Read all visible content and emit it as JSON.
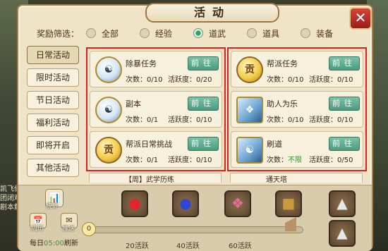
{
  "window": {
    "title": "活动",
    "close_label": "✕"
  },
  "filter": {
    "label": "奖励筛选：",
    "options": [
      {
        "label": "全部",
        "selected": false
      },
      {
        "label": "经验",
        "selected": false
      },
      {
        "label": "道武",
        "selected": true
      },
      {
        "label": "道具",
        "selected": false
      },
      {
        "label": "装备",
        "selected": false
      }
    ]
  },
  "sidebar": {
    "items": [
      {
        "label": "日常活动",
        "active": true
      },
      {
        "label": "限时活动",
        "active": false
      },
      {
        "label": "节日活动",
        "active": false
      },
      {
        "label": "福利活动",
        "active": false
      },
      {
        "label": "即将开启",
        "active": false
      },
      {
        "label": "其他活动",
        "active": false
      }
    ]
  },
  "cards": [
    {
      "title": "除暴任务",
      "count": "次数：0/10",
      "activity": "活跃度：0/20",
      "go": "前往",
      "icon": "taiji-icon"
    },
    {
      "title": "帮派任务",
      "count": "次数：0/10",
      "activity": "活跃度：0/10",
      "go": "前往",
      "icon": "coin-icon"
    },
    {
      "title": "副本",
      "count": "次数：0/1",
      "activity": "活跃度：0/10",
      "go": "前往",
      "icon": "taiji-icon"
    },
    {
      "title": "助人为乐",
      "count": "次数：0/10",
      "activity": "活跃度：0/10",
      "go": "前往",
      "icon": "book-icon"
    },
    {
      "title": "帮派日常挑战",
      "count": "次数：0/1",
      "activity": "活跃度：0/10",
      "go": "前往",
      "icon": "coin-icon"
    },
    {
      "title": "刷道",
      "count_prefix": "次数：",
      "count_value": "不限",
      "activity": "活跃度：0/50",
      "go": "前往",
      "icon": "book-taiji-icon"
    }
  ],
  "peek": {
    "left": "【周】武学历练",
    "right": "通天塔"
  },
  "icon_glyphs": {
    "coin": "贡",
    "taiji": "☯",
    "book": "❖"
  },
  "rewards": {
    "milestones": [
      "20活跃",
      "40活跃",
      "60活跃"
    ],
    "progress_start": "0",
    "refresh_prefix": "每日",
    "refresh_time": "05:00",
    "refresh_suffix": "刷新"
  },
  "bottom_left": {
    "stats_glyph": "📊",
    "stats_label": "统计",
    "calendar_glyph": "📅",
    "calendar_label": "周历",
    "mail_glyph": "✉",
    "mail_label": "推送"
  },
  "side_text": "凯飞仙\n团闭难\n剧本解"
}
